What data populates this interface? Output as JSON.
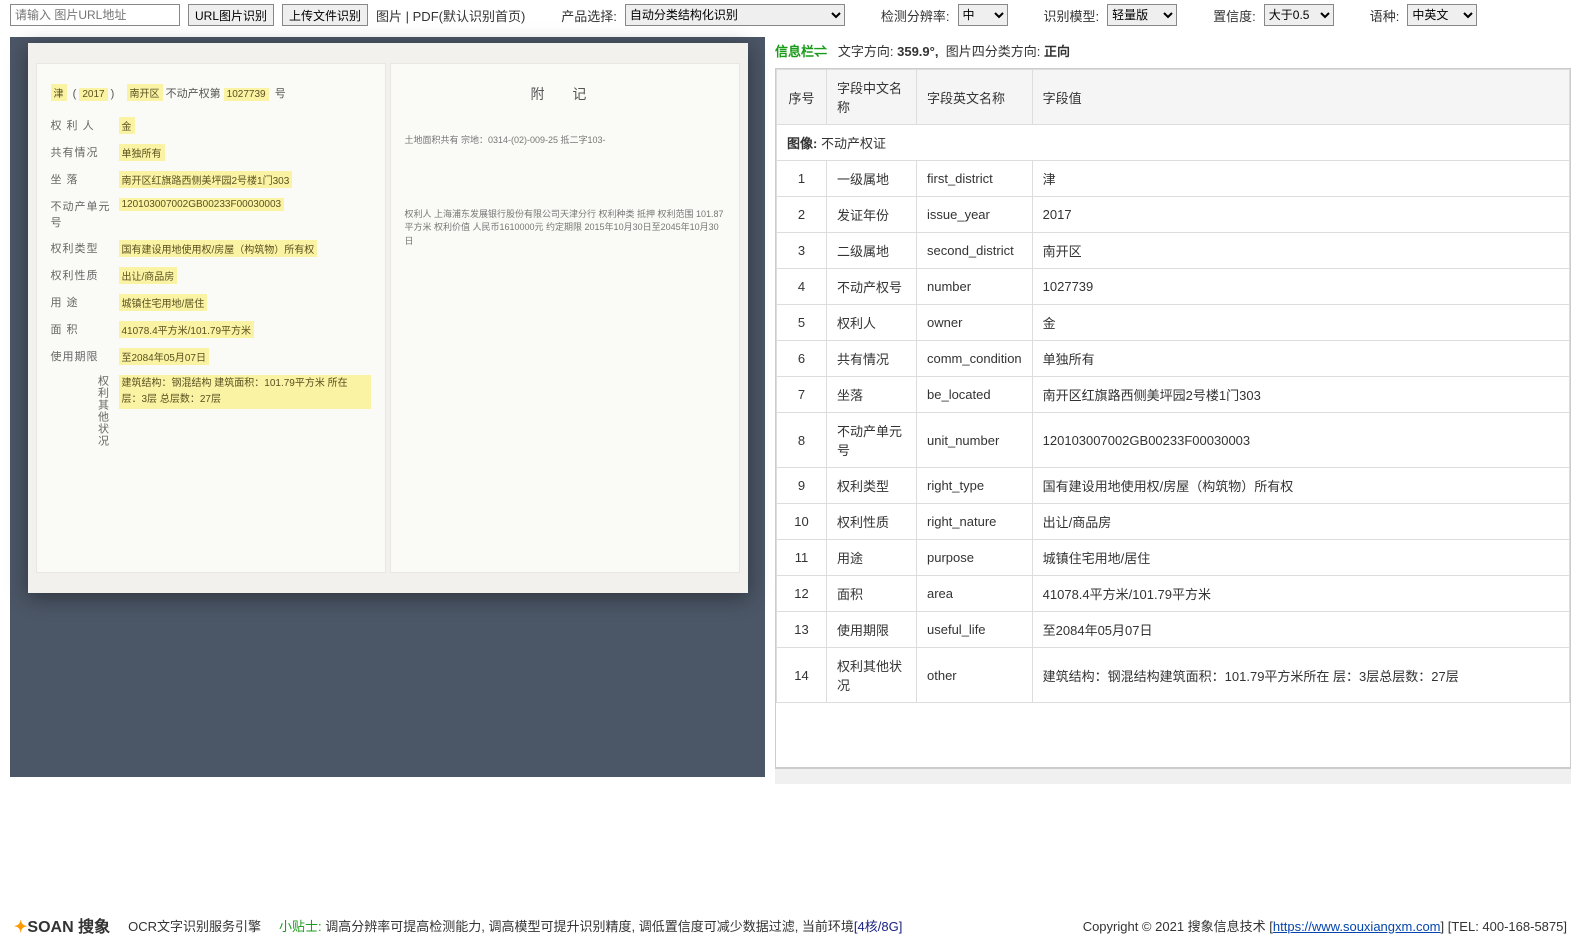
{
  "toolbar": {
    "url_placeholder": "请输入 图片URL地址",
    "btn_url": "URL图片识别",
    "btn_upload": "上传文件识别",
    "lbl_filetype": "图片 | PDF(默认识别首页)",
    "lbl_product": "产品选择:",
    "sel_product": "自动分类结构化识别",
    "lbl_res": "检测分辨率:",
    "sel_res": "中",
    "lbl_model": "识别模型:",
    "sel_model": "轻量版",
    "lbl_conf": "置信度:",
    "sel_conf": "大于0.5",
    "lbl_lang": "语种:",
    "sel_lang": "中英文"
  },
  "doc_left": {
    "header_a": "津",
    "header_b": "2017",
    "header_c": "南开区",
    "header_d": "不动产权第",
    "header_e": "1027739",
    "header_f": "号",
    "rows": [
      {
        "k": "权 利 人",
        "v": "金"
      },
      {
        "k": "共有情况",
        "v": "单独所有"
      },
      {
        "k": "坐   落",
        "v": "南开区红旗路西侧美坪园2号楼1门303"
      },
      {
        "k": "不动产单元号",
        "v": "120103007002GB00233F00030003"
      },
      {
        "k": "权利类型",
        "v": "国有建设用地使用权/房屋（构筑物）所有权"
      },
      {
        "k": "权利性质",
        "v": "出让/商品房"
      },
      {
        "k": "用   途",
        "v": "城镇住宅用地/居住"
      },
      {
        "k": "面   积",
        "v": "41078.4平方米/101.79平方米"
      },
      {
        "k": "使用期限",
        "v": "至2084年05月07日"
      }
    ],
    "other_k": "权利其他状况",
    "other_v": "建筑结构：钢混结构 建筑面积：101.79平方米 所在 层：3层 总层数：27层"
  },
  "doc_right": {
    "title": "附   记",
    "note1": "土地面积共有  宗地：0314-(02)-009-25 抵二字103-",
    "note2": "权利人  上海浦东发展银行股份有限公司天津分行  权利种类 抵押  权利范围 101.87平方米  权利价值 人民币1610000元  约定期限 2015年10月30日至2045年10月30日"
  },
  "info": {
    "label": "信息栏⇌",
    "dir_lbl": "文字方向:",
    "dir_val": "359.9°,",
    "quad_lbl": "图片四分类方向:",
    "quad_val": "正向"
  },
  "table": {
    "headers": [
      "序号",
      "字段中文名称",
      "字段英文名称",
      "字段值"
    ],
    "img_row": {
      "label": "图像:",
      "value": "不动产权证"
    },
    "rows": [
      {
        "n": "1",
        "cn": "一级属地",
        "en": "first_district",
        "v": "津"
      },
      {
        "n": "2",
        "cn": "发证年份",
        "en": "issue_year",
        "v": "2017"
      },
      {
        "n": "3",
        "cn": "二级属地",
        "en": "second_district",
        "v": "南开区"
      },
      {
        "n": "4",
        "cn": "不动产权号",
        "en": "number",
        "v": "1027739"
      },
      {
        "n": "5",
        "cn": "权利人",
        "en": "owner",
        "v": "金"
      },
      {
        "n": "6",
        "cn": "共有情况",
        "en": "comm_condition",
        "v": "单独所有"
      },
      {
        "n": "7",
        "cn": "坐落",
        "en": "be_located",
        "v": "南开区红旗路西侧美坪园2号楼1门303"
      },
      {
        "n": "8",
        "cn": "不动产单元号",
        "en": "unit_number",
        "v": "120103007002GB00233F00030003"
      },
      {
        "n": "9",
        "cn": "权利类型",
        "en": "right_type",
        "v": "国有建设用地使用权/房屋（构筑物）所有权"
      },
      {
        "n": "10",
        "cn": "权利性质",
        "en": "right_nature",
        "v": "出让/商品房"
      },
      {
        "n": "11",
        "cn": "用途",
        "en": "purpose",
        "v": "城镇住宅用地/居住"
      },
      {
        "n": "12",
        "cn": "面积",
        "en": "area",
        "v": "41078.4平方米/101.79平方米"
      },
      {
        "n": "13",
        "cn": "使用期限",
        "en": "useful_life",
        "v": "至2084年05月07日"
      },
      {
        "n": "14",
        "cn": "权利其他状况",
        "en": "other",
        "v": "建筑结构：钢混结构建筑面积：101.79平方米所在 层：3层总层数：27层"
      }
    ]
  },
  "footer": {
    "logo_a": "SOAN",
    "logo_b": "搜象",
    "engine": "OCR文字识别服务引擎",
    "tip_lbl": "小贴士:",
    "tip_txt": "调高分辨率可提高检测能力, 调高模型可提升识别精度, 调低置信度可减少数据过滤, 当前环境",
    "env": "[4核/8G]",
    "copy_a": "Copyright © 2021 搜象信息技术 [",
    "copy_link": "https://www.souxiangxm.com",
    "copy_b": "] [TEL: 400-168-5875]"
  }
}
